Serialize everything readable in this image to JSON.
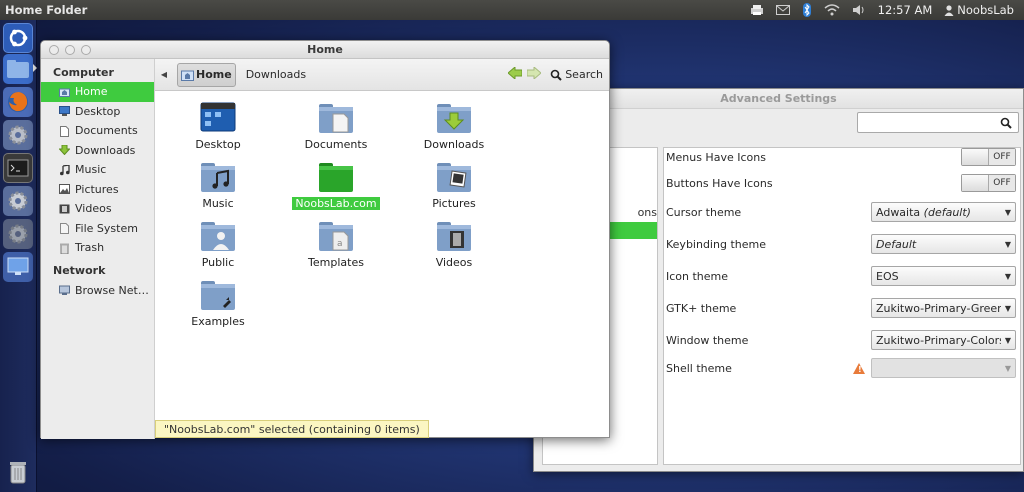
{
  "panel": {
    "title": "Home Folder",
    "clock": "12:57 AM",
    "user": "NoobsLab"
  },
  "nautilus": {
    "title": "Home",
    "sidebar": {
      "computer_heading": "Computer",
      "items": [
        {
          "label": "Home",
          "icon": "home-folder-icon"
        },
        {
          "label": "Desktop",
          "icon": "desktop-icon"
        },
        {
          "label": "Documents",
          "icon": "documents-icon"
        },
        {
          "label": "Downloads",
          "icon": "download-icon"
        },
        {
          "label": "Music",
          "icon": "music-note-icon"
        },
        {
          "label": "Pictures",
          "icon": "pictures-icon"
        },
        {
          "label": "Videos",
          "icon": "film-icon"
        },
        {
          "label": "File System",
          "icon": "drive-icon"
        },
        {
          "label": "Trash",
          "icon": "trash-icon"
        }
      ],
      "network_heading": "Network",
      "network_items": [
        {
          "label": "Browse Net…",
          "icon": "network-icon"
        }
      ]
    },
    "toolbar": {
      "home_label": "Home",
      "downloads_label": "Downloads",
      "search_label": "Search"
    },
    "files": [
      {
        "label": "Desktop"
      },
      {
        "label": "Documents"
      },
      {
        "label": "Downloads"
      },
      {
        "label": "Music"
      },
      {
        "label": "NoobsLab.com"
      },
      {
        "label": "Pictures"
      },
      {
        "label": "Public"
      },
      {
        "label": "Templates"
      },
      {
        "label": "Videos"
      },
      {
        "label": "Examples"
      }
    ],
    "status": "\"NoobsLab.com\" selected (containing 0 items)",
    "colors": {
      "selection": "#3fcb3f",
      "folder": "#6f8fb8"
    }
  },
  "advanced_settings": {
    "title": "Advanced Settings",
    "left_visible_text": "ons",
    "rows": {
      "menus_icons": {
        "label": "Menus Have Icons",
        "state": "OFF"
      },
      "buttons_icons": {
        "label": "Buttons Have Icons",
        "state": "OFF"
      },
      "cursor": {
        "label": "Cursor theme",
        "value": "Adwaita",
        "value_suffix": "(default)"
      },
      "keybinding": {
        "label": "Keybinding theme",
        "value": "Default"
      },
      "icon": {
        "label": "Icon theme",
        "value": "EOS"
      },
      "gtk": {
        "label": "GTK+ theme",
        "value": "Zukitwo-Primary-Green"
      },
      "window": {
        "label": "Window theme",
        "value": "Zukitwo-Primary-Colors"
      },
      "shell": {
        "label": "Shell theme",
        "value": ""
      }
    }
  }
}
